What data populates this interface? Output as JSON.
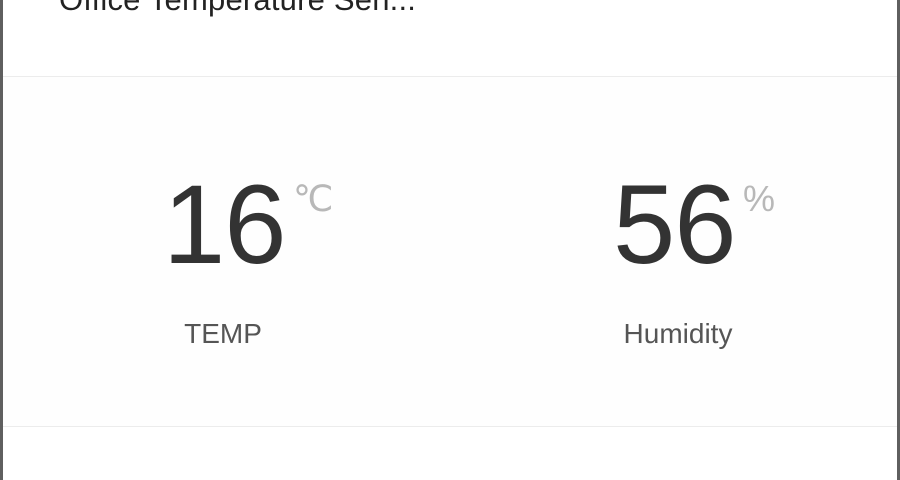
{
  "header": {
    "device_name": "Office Temperature Sen..."
  },
  "metrics": {
    "temperature": {
      "value": "16",
      "unit": "℃",
      "label": "TEMP"
    },
    "humidity": {
      "value": "56",
      "unit": "%",
      "label": "Humidity"
    }
  },
  "colors": {
    "background": "#5f5f5f",
    "card": "#ffffff",
    "primary_text": "#333333",
    "unit_text": "#b8b8b8",
    "label_text": "#555555",
    "divider": "#ececec"
  }
}
